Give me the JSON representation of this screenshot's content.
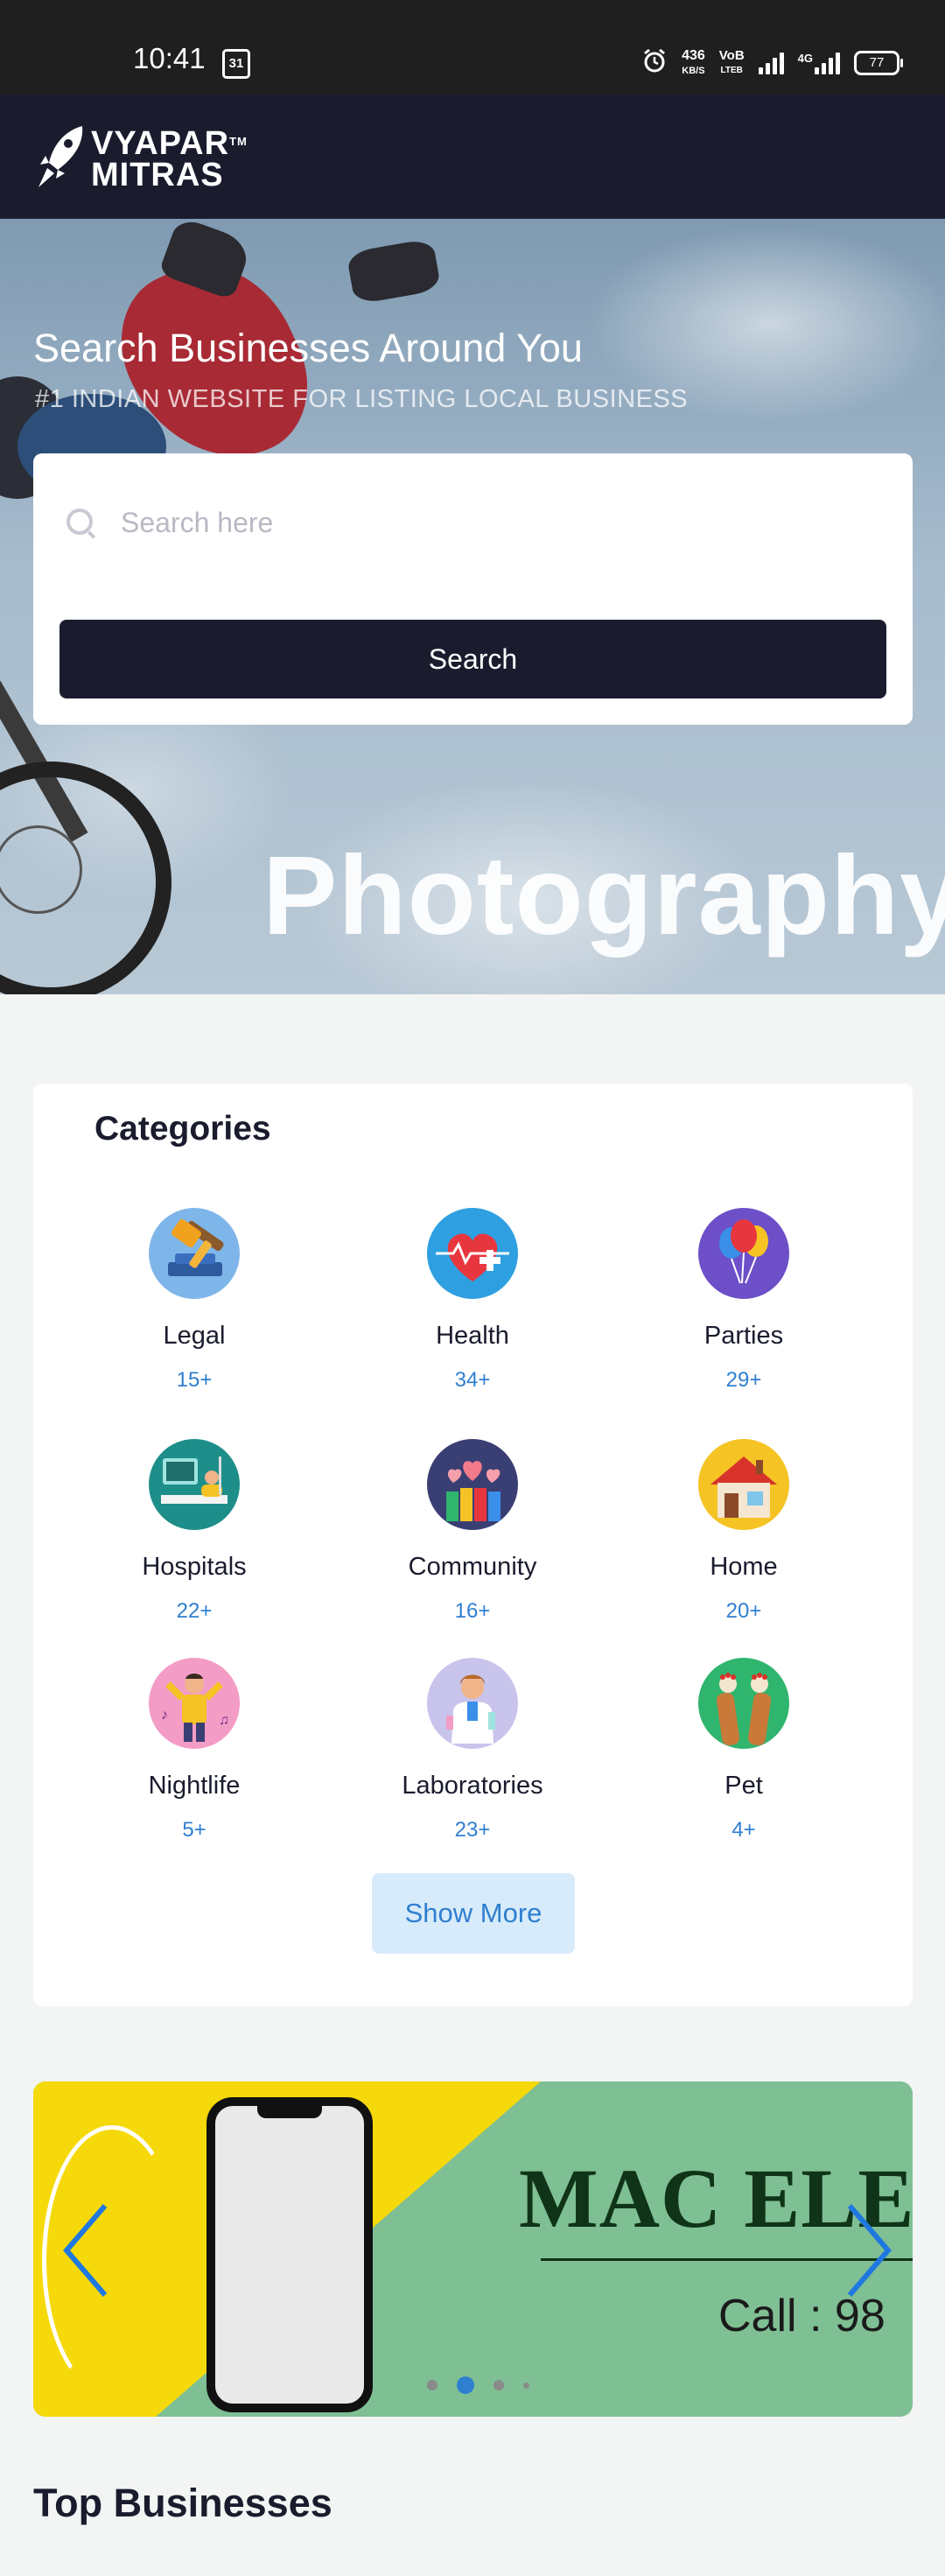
{
  "status_bar": {
    "time": "10:41",
    "calendar_day": "31",
    "net_speed_value": "436",
    "net_speed_unit": "KB/S",
    "volte_top": "VoB",
    "volte_bottom": "LTEB",
    "network": "4G",
    "battery": "77"
  },
  "header": {
    "logo_line1": "VYAPAR",
    "logo_line2": "MITRAS",
    "logo_tm": "TM"
  },
  "hero": {
    "title": "Search Businesses Around You",
    "subtitle": "#1 INDIAN WEBSITE FOR LISTING LOCAL BUSINESS",
    "search_placeholder": "Search here",
    "search_value": "",
    "search_button": "Search",
    "background_caption": "Photography"
  },
  "categories": {
    "title": "Categories",
    "items": [
      {
        "name": "Legal",
        "count": "15+",
        "icon": "gavel-icon"
      },
      {
        "name": "Health",
        "count": "34+",
        "icon": "heart-health-icon"
      },
      {
        "name": "Parties",
        "count": "29+",
        "icon": "balloons-icon"
      },
      {
        "name": "Hospitals",
        "count": "22+",
        "icon": "hospital-bed-icon"
      },
      {
        "name": "Community",
        "count": "16+",
        "icon": "community-hearts-icon"
      },
      {
        "name": "Home",
        "count": "20+",
        "icon": "house-icon"
      },
      {
        "name": "Nightlife",
        "count": "5+",
        "icon": "dancer-icon"
      },
      {
        "name": "Laboratories",
        "count": "23+",
        "icon": "scientist-icon"
      },
      {
        "name": "Pet",
        "count": "4+",
        "icon": "paw-icon"
      }
    ],
    "show_more": "Show More"
  },
  "banner": {
    "brand_text": "MAC ELE",
    "call_text": "Call : 98",
    "slides_total": 4,
    "active_slide": 2
  },
  "top_businesses": {
    "title": "Top Businesses"
  },
  "colors": {
    "navy": "#1a1c2e",
    "accent_blue": "#2f7fd0",
    "show_more_bg": "#d8ebfb",
    "page_bg": "#f3f4f4"
  }
}
